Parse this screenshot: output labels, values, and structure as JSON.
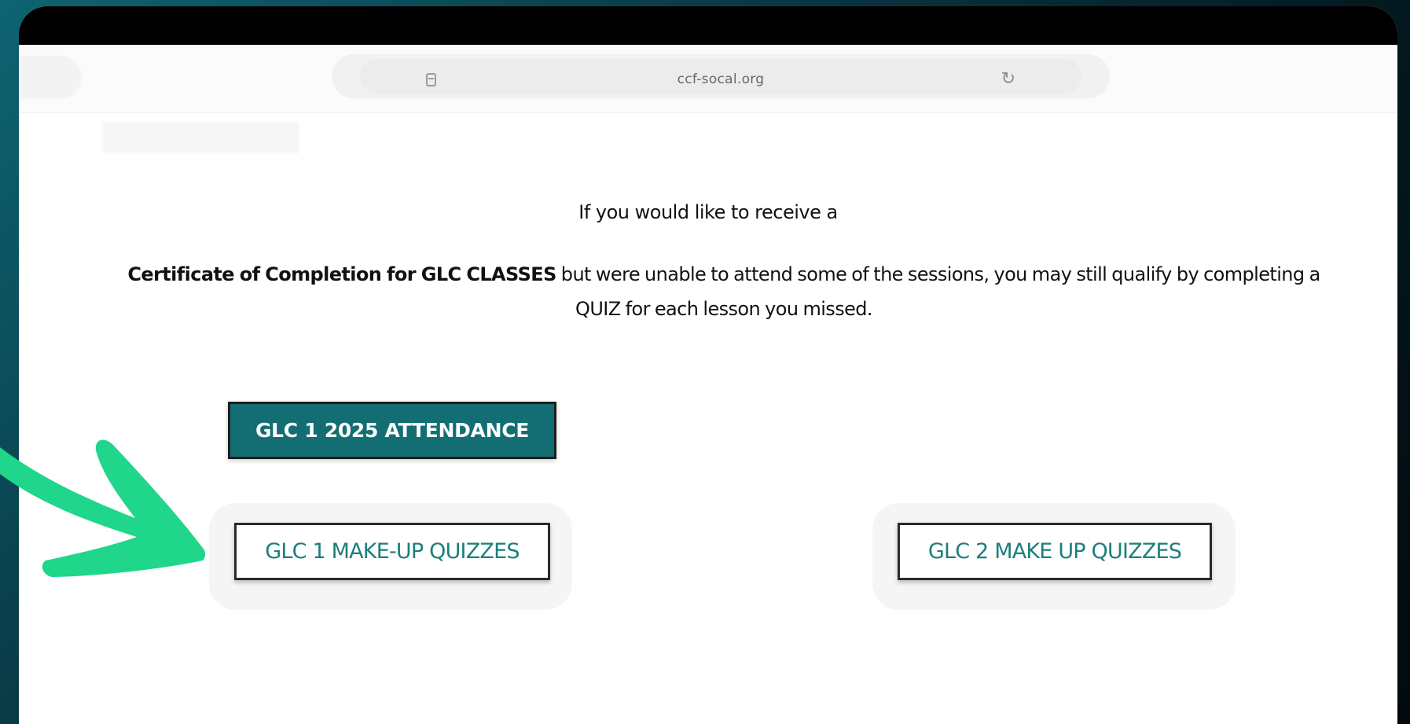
{
  "browser": {
    "url": "ccf-socal.org"
  },
  "content": {
    "intro": "If you would like to receive a",
    "para_bold": "Certificate of Completion for GLC CLASSES",
    "para_rest": " but were unable to attend some of the sessions, you may still qualify by completing a QUIZ for each lesson you missed."
  },
  "buttons": {
    "attendance": "GLC 1 2025 ATTENDANCE",
    "glc1_quizzes": "GLC 1 MAKE-UP QUIZZES",
    "glc2_quizzes": "GLC 2 MAKE UP QUIZZES"
  },
  "colors": {
    "brand_teal": "#126e73",
    "outline_text_teal": "#1b7f7c",
    "annotation_arrow": "#1fd68a"
  },
  "icons": {
    "page": "page-icon",
    "reload": "reload-icon",
    "annotation": "annotation-arrow-icon"
  }
}
